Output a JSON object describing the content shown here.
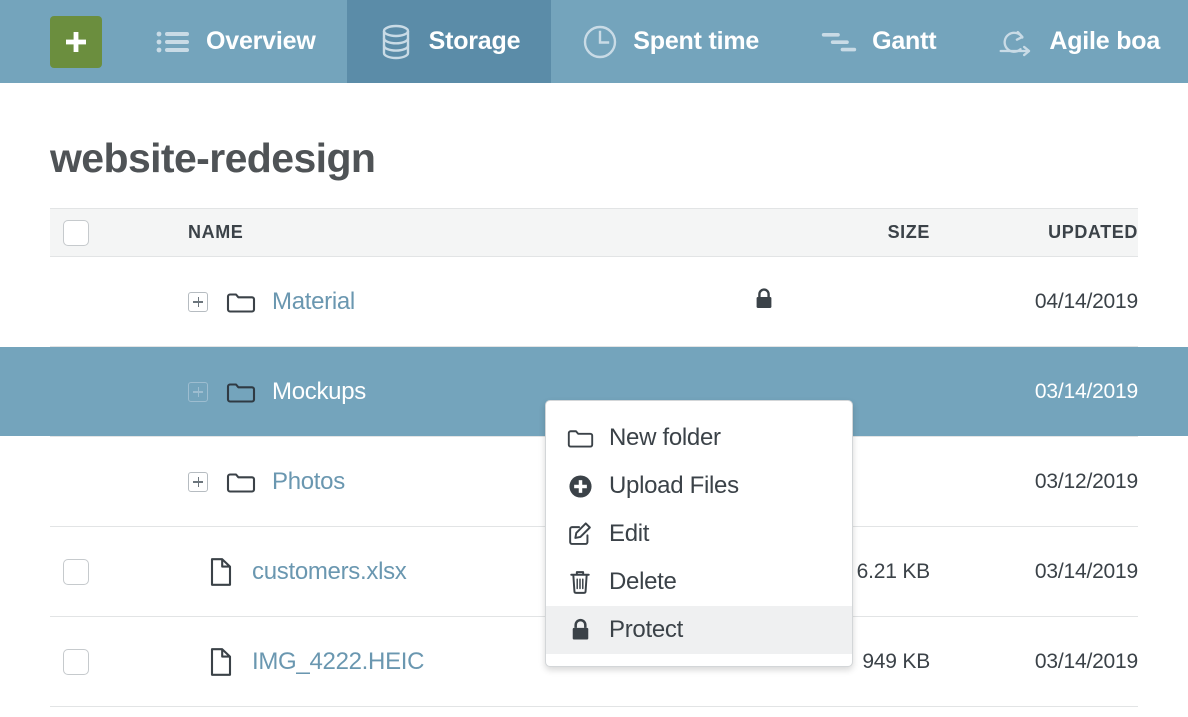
{
  "nav": {
    "add_button": {
      "label": "+",
      "icon": "plus-icon",
      "color": "#6b8e3e"
    },
    "tabs": [
      {
        "id": "overview",
        "label": "Overview",
        "icon": "list-icon",
        "active": false
      },
      {
        "id": "storage",
        "label": "Storage",
        "icon": "database-icon",
        "active": true
      },
      {
        "id": "spent-time",
        "label": "Spent time",
        "icon": "clock-icon",
        "active": false
      },
      {
        "id": "gantt",
        "label": "Gantt",
        "icon": "gantt-icon",
        "active": false
      },
      {
        "id": "agile-board",
        "label": "Agile boa",
        "icon": "agile-icon",
        "active": false
      }
    ],
    "background": "#74a4bc",
    "active_background": "#5b8ca8"
  },
  "page": {
    "title": "website-redesign"
  },
  "table": {
    "columns": {
      "name": "NAME",
      "size": "SIZE",
      "updated": "UPDATED"
    },
    "select_all_checked": false,
    "rows": [
      {
        "type": "folder",
        "name": "Material",
        "icon": "folder-icon",
        "expandable": true,
        "locked": true,
        "size": "",
        "updated": "04/14/2019",
        "selected": false
      },
      {
        "type": "folder",
        "name": "Mockups",
        "icon": "folder-icon",
        "expandable": true,
        "locked": false,
        "size": "",
        "updated": "03/14/2019",
        "selected": true
      },
      {
        "type": "folder",
        "name": "Photos",
        "icon": "folder-icon",
        "expandable": true,
        "locked": false,
        "size": "",
        "updated": "03/12/2019",
        "selected": false
      },
      {
        "type": "file",
        "name": "customers.xlsx",
        "icon": "file-icon",
        "expandable": false,
        "locked": true,
        "size": "6.21 KB",
        "updated": "03/14/2019",
        "selected": false
      },
      {
        "type": "file",
        "name": "IMG_4222.HEIC",
        "icon": "file-icon",
        "expandable": false,
        "locked": false,
        "size": "949 KB",
        "updated": "03/14/2019",
        "selected": false
      }
    ]
  },
  "context_menu": {
    "items": [
      {
        "id": "new-folder",
        "label": "New folder",
        "icon": "folder-icon",
        "hover": false
      },
      {
        "id": "upload-files",
        "label": "Upload Files",
        "icon": "plus-circle-icon",
        "hover": false
      },
      {
        "id": "edit",
        "label": "Edit",
        "icon": "edit-icon",
        "hover": false
      },
      {
        "id": "delete",
        "label": "Delete",
        "icon": "trash-icon",
        "hover": false
      },
      {
        "id": "protect",
        "label": "Protect",
        "icon": "lock-icon",
        "hover": true
      }
    ]
  }
}
